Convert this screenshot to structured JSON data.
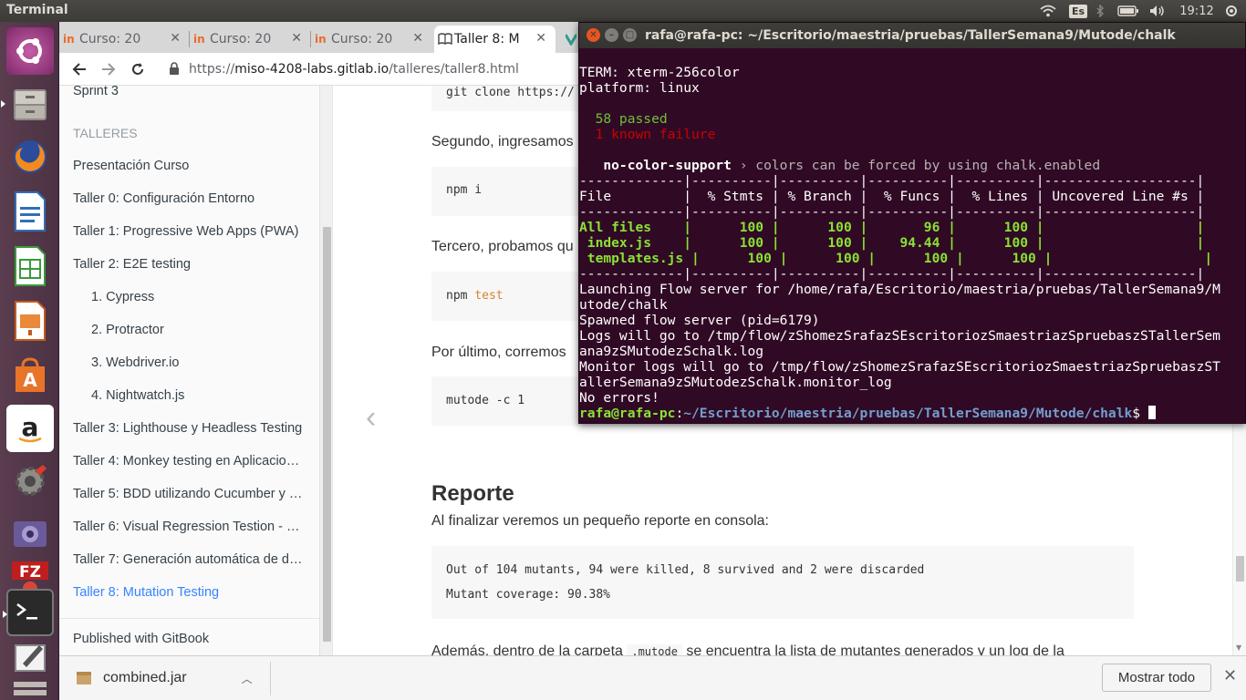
{
  "top_panel": {
    "title": "Terminal",
    "keyboard_layout": "Es",
    "clock": "19:12"
  },
  "launcher": {
    "items": [
      {
        "name": "ubuntu-dash"
      },
      {
        "name": "files"
      },
      {
        "name": "firefox"
      },
      {
        "name": "libreoffice-writer"
      },
      {
        "name": "libreoffice-calc"
      },
      {
        "name": "libreoffice-impress"
      },
      {
        "name": "ubuntu-software"
      },
      {
        "name": "amazon"
      },
      {
        "name": "system-settings"
      },
      {
        "name": "screen-recorder"
      },
      {
        "name": "filezilla-chrome"
      },
      {
        "name": "terminal"
      },
      {
        "name": "text-editor"
      },
      {
        "name": "workspaces"
      }
    ]
  },
  "browser": {
    "tabs": [
      {
        "label": "Curso: 20",
        "favicon": "in",
        "active": false
      },
      {
        "label": "Curso: 20",
        "favicon": "in",
        "active": false
      },
      {
        "label": "Curso: 20",
        "favicon": "in",
        "active": false
      },
      {
        "label": "Taller 8: M",
        "favicon": "book",
        "active": true
      }
    ],
    "url": {
      "scheme": "https://",
      "host": "miso-4208-labs.gitlab.io",
      "path": "/talleres/taller8.html"
    }
  },
  "sidebar": {
    "items": [
      {
        "label": "Sprint 3",
        "kind": "item"
      },
      {
        "label": "TALLERES",
        "kind": "header"
      },
      {
        "label": "Presentación Curso",
        "kind": "item"
      },
      {
        "label": "Taller 0: Configuración Entorno",
        "kind": "item"
      },
      {
        "label": "Taller 1: Progressive Web Apps (PWA)",
        "kind": "item"
      },
      {
        "label": "Taller 2: E2E testing",
        "kind": "item"
      },
      {
        "label": "1. Cypress",
        "kind": "sub"
      },
      {
        "label": "2. Protractor",
        "kind": "sub"
      },
      {
        "label": "3. Webdriver.io",
        "kind": "sub"
      },
      {
        "label": "4. Nightwatch.js",
        "kind": "sub"
      },
      {
        "label": "Taller 3: Lighthouse y Headless Testing",
        "kind": "item"
      },
      {
        "label": "Taller 4: Monkey testing en Aplicacio…",
        "kind": "item"
      },
      {
        "label": "Taller 5: BDD utilizando Cucumber y …",
        "kind": "item"
      },
      {
        "label": "Taller 6: Visual Regression Testion - …",
        "kind": "item"
      },
      {
        "label": "Taller 7: Generación automática de d…",
        "kind": "item"
      },
      {
        "label": "Taller 8: Mutation Testing",
        "kind": "active"
      }
    ],
    "footer": "Published with GitBook"
  },
  "content": {
    "code_top_fragment": "git clone https://",
    "p_segundo": "Segundo, ingresamos",
    "code_npm_i": "npm i",
    "p_tercero": "Tercero, probamos qu",
    "code_npm_test_cmd": "npm",
    "code_npm_test_arg": "test",
    "p_ultimo": "Por último, corremos",
    "code_mutode": "mutode -c 1",
    "h_reporte": "Reporte",
    "p_finalizar": "Al finalizar veremos un pequeño reporte en consola:",
    "report_line1": "Out of 104 mutants, 94 were killed, 8 survived and 2 were discarded",
    "report_line2": "Mutant coverage: 90.38%",
    "p_ademas_pre": "Además, dentro de la carpeta",
    "p_ademas_code": ".mutode",
    "p_ademas_post": "se encuentra la lista de mutantes generados y un log de la"
  },
  "downloads": {
    "file": "combined.jar",
    "show_all": "Mostrar todo"
  },
  "terminal": {
    "title": "rafa@rafa-pc: ~/Escritorio/maestria/pruebas/TallerSemana9/Mutode/chalk",
    "lines": {
      "term": "TERM: xterm-256color",
      "platform": "platform: linux",
      "passed": "  58 passed",
      "failure": "  1 known failure",
      "nocolor_title": "   no-color-support",
      "nocolor_sep": " › ",
      "nocolor_desc": "colors can be forced by using chalk.enabled",
      "table_sep": "-------------|----------|----------|----------|----------|-------------------|",
      "table_header": "File         |  % Stmts | % Branch |  % Funcs |  % Lines | Uncovered Line #s |",
      "table_all": "All files    |      100 |      100 |       96 |      100 |                   |",
      "table_index": " index.js    |      100 |      100 |    94.44 |      100 |                   |",
      "table_templates": " templates.js |      100 |      100 |      100 |      100 |                   |",
      "launch1": "Launching Flow server for /home/rafa/Escritorio/maestria/pruebas/TallerSemana9/M",
      "launch2": "utode/chalk",
      "spawned": "Spawned flow server (pid=6179)",
      "logs1": "Logs will go to /tmp/flow/zShomezSrafazSEscritoriozSmaestriazSpruebaszSTallerSem",
      "logs2": "ana9zSMutodezSchalk.log",
      "mon1": "Monitor logs will go to /tmp/flow/zShomezSrafazSEscritoriozSmaestriazSpruebaszST",
      "mon2": "allerSemana9zSMutodezSchalk.monitor_log",
      "noerr": "No errors!",
      "prompt_user": "rafa@rafa-pc",
      "prompt_colon": ":",
      "prompt_path": "~/Escritorio/maestria/pruebas/TallerSemana9/Mutode/chalk",
      "prompt_dollar": "$ "
    }
  }
}
